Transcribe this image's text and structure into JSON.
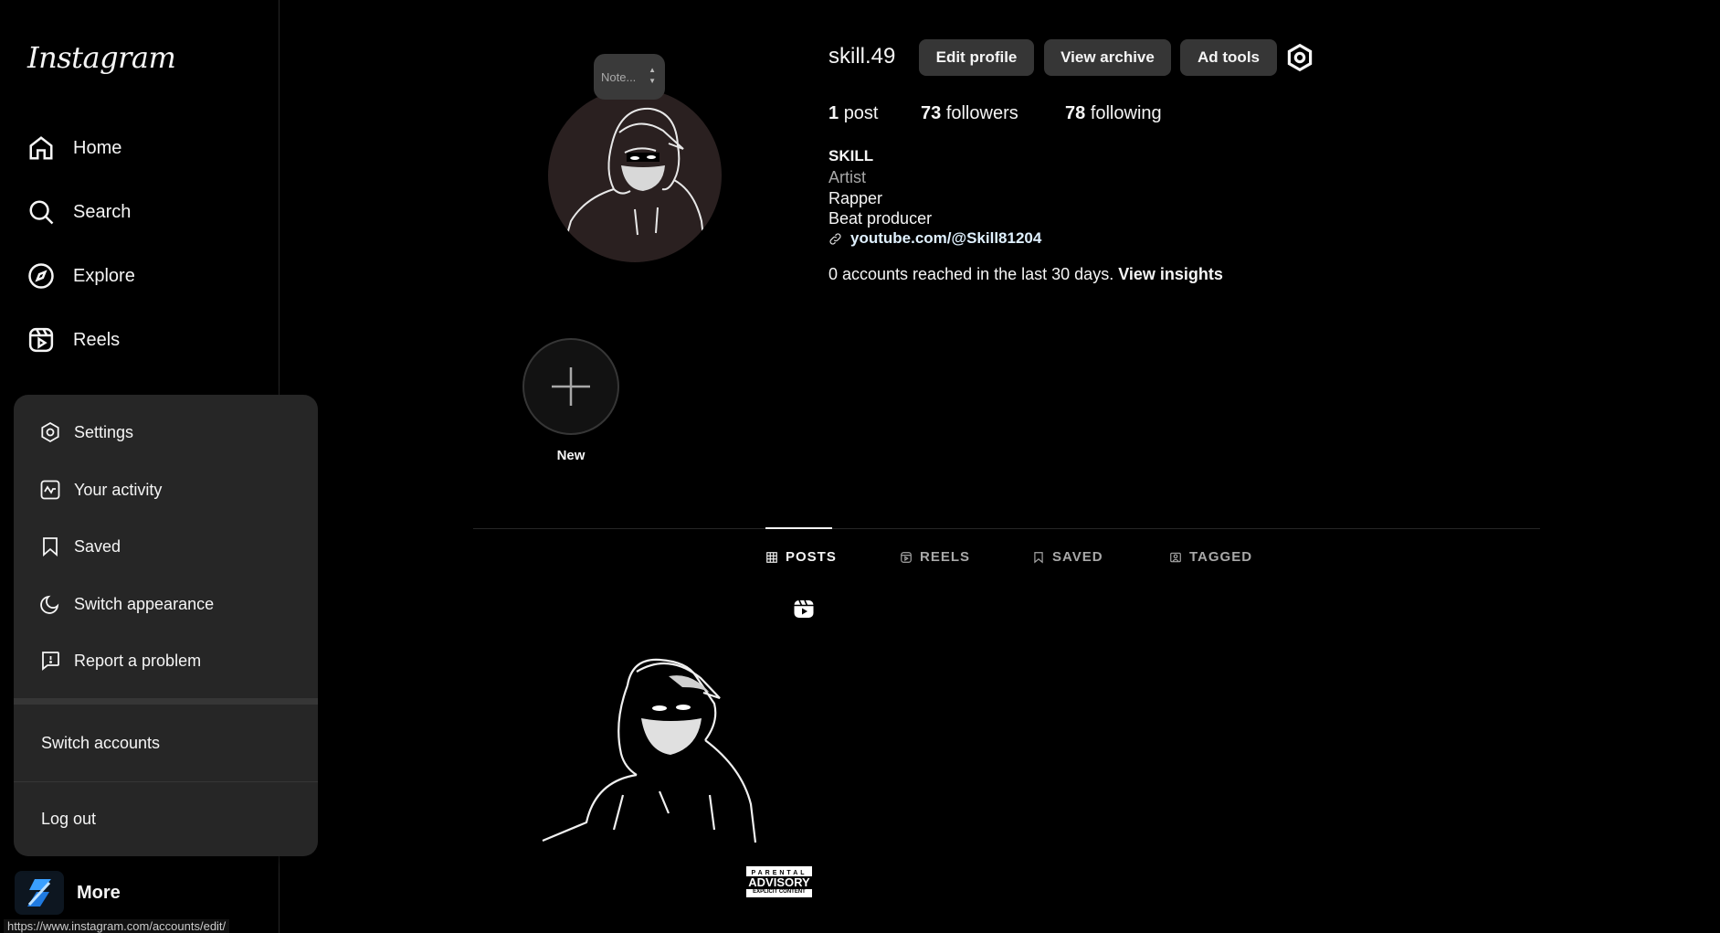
{
  "app": {
    "logo_text": "Instagram"
  },
  "sidebar": {
    "items": [
      {
        "label": "Home",
        "icon": "home-icon"
      },
      {
        "label": "Search",
        "icon": "search-icon"
      },
      {
        "label": "Explore",
        "icon": "compass-icon"
      },
      {
        "label": "Reels",
        "icon": "reels-icon"
      }
    ],
    "more_label": "More"
  },
  "menu": {
    "items": [
      {
        "label": "Settings",
        "icon": "gear-icon"
      },
      {
        "label": "Your activity",
        "icon": "activity-icon"
      },
      {
        "label": "Saved",
        "icon": "bookmark-icon"
      },
      {
        "label": "Switch appearance",
        "icon": "moon-icon"
      },
      {
        "label": "Report a problem",
        "icon": "report-icon"
      }
    ],
    "switch_accounts": "Switch accounts",
    "log_out": "Log out"
  },
  "status_url": "https://www.instagram.com/accounts/edit/",
  "profile": {
    "note_placeholder": "Note...",
    "username": "skill.49",
    "buttons": {
      "edit": "Edit profile",
      "archive": "View archive",
      "ad_tools": "Ad tools"
    },
    "stats": {
      "posts_count": "1",
      "posts_label": "post",
      "followers_count": "73",
      "followers_label": "followers",
      "following_count": "78",
      "following_label": "following"
    },
    "bio": {
      "name": "SKILL",
      "category": "Artist",
      "line1": "Rapper",
      "line2": "Beat producer",
      "link": "youtube.com/@Skill81204"
    },
    "reach_text": "0 accounts reached in the last 30 days.",
    "reach_link": "View insights",
    "highlight_new": "New"
  },
  "tabs": [
    {
      "label": "POSTS",
      "active": true,
      "icon": "grid-icon"
    },
    {
      "label": "REELS",
      "active": false,
      "icon": "reels-icon"
    },
    {
      "label": "SAVED",
      "active": false,
      "icon": "bookmark-icon"
    },
    {
      "label": "TAGGED",
      "active": false,
      "icon": "tagged-icon"
    }
  ],
  "post": {
    "advisory_top": "PARENTAL",
    "advisory_mid": "ADVISORY",
    "advisory_bottom": "EXPLICIT CONTENT"
  }
}
